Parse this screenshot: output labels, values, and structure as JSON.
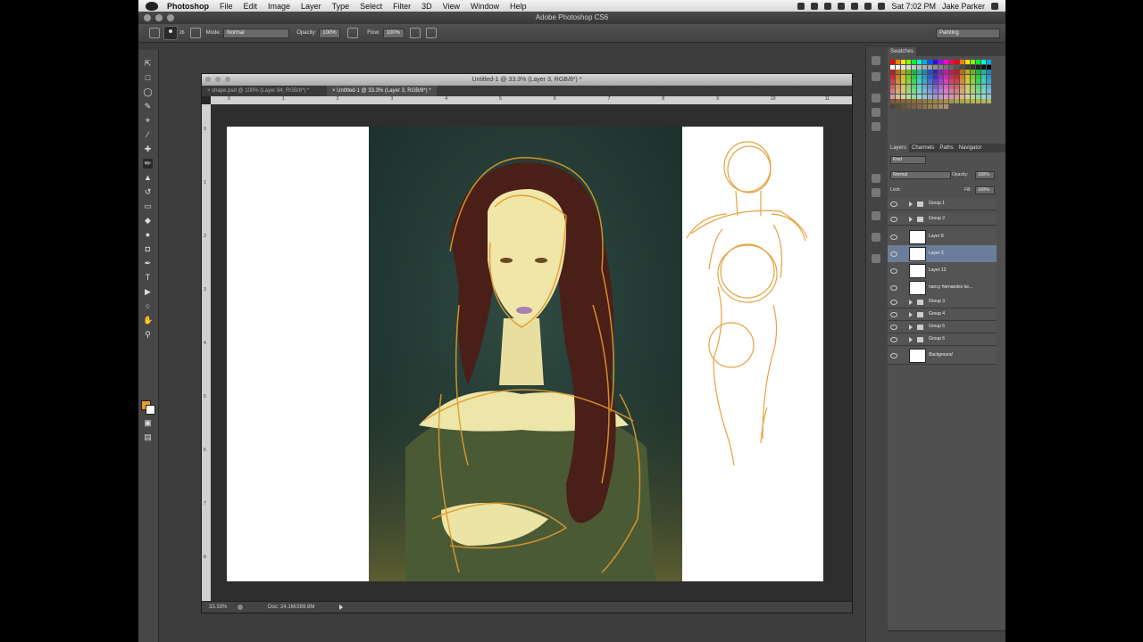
{
  "menubar": {
    "items": [
      "Photoshop",
      "File",
      "Edit",
      "Image",
      "Layer",
      "Type",
      "Select",
      "Filter",
      "3D",
      "View",
      "Window",
      "Help"
    ],
    "clock": "Sat 7:02 PM",
    "user": "Jake Parker"
  },
  "app_title": "Adobe Photoshop CS6",
  "options": {
    "brush_size": "26",
    "mode_label": "Mode:",
    "mode_value": "Normal",
    "opacity_label": "Opacity:",
    "opacity_value": "100%",
    "flow_label": "Flow:",
    "flow_value": "100%",
    "workspace": "Painting"
  },
  "document": {
    "title": "Untitled-1 @ 33.3% (Layer 3, RGB/8*) *",
    "tabs": [
      "shape.psd @ 100% (Layer 84, RGB/8*) *",
      "Untitled-1 @ 33.3% (Layer 3, RGB/8*) *"
    ],
    "ruler_h": [
      "0",
      "1",
      "2",
      "3",
      "4",
      "5",
      "6",
      "7",
      "8",
      "9",
      "10",
      "11"
    ],
    "ruler_v": [
      "0",
      "1",
      "2",
      "3",
      "4",
      "5",
      "6",
      "7",
      "8"
    ],
    "zoom": "33.33%",
    "doc_size": "Doc: 24.1M/289.8M"
  },
  "panels": {
    "swatches_tab": "Swatches",
    "layer_tabs": [
      "Layers",
      "Channels",
      "Paths",
      "Navigator"
    ],
    "kind_label": "Kind",
    "blend_mode": "Normal",
    "opacity_label": "Opacity:",
    "opacity_value": "100%",
    "lock_label": "Lock:",
    "fill_label": "Fill:",
    "fill_value": "100%",
    "layers": [
      {
        "name": "Group 1",
        "type": "group"
      },
      {
        "name": "Group 2",
        "type": "group-open"
      },
      {
        "name": "Layer 8",
        "type": "layer"
      },
      {
        "name": "Layer 3",
        "type": "layer",
        "selected": true
      },
      {
        "name": "Layer 12",
        "type": "layer"
      },
      {
        "name": "nancy hernandez ke...",
        "type": "layer"
      },
      {
        "name": "Group 3",
        "type": "group"
      },
      {
        "name": "Group 4",
        "type": "group"
      },
      {
        "name": "Group 5",
        "type": "group"
      },
      {
        "name": "Group 6",
        "type": "group"
      },
      {
        "name": "Background",
        "type": "background"
      }
    ]
  },
  "colors": {
    "foreground": "#ec9a2e",
    "background": "#ffffff",
    "selection": "#6a7d99"
  }
}
